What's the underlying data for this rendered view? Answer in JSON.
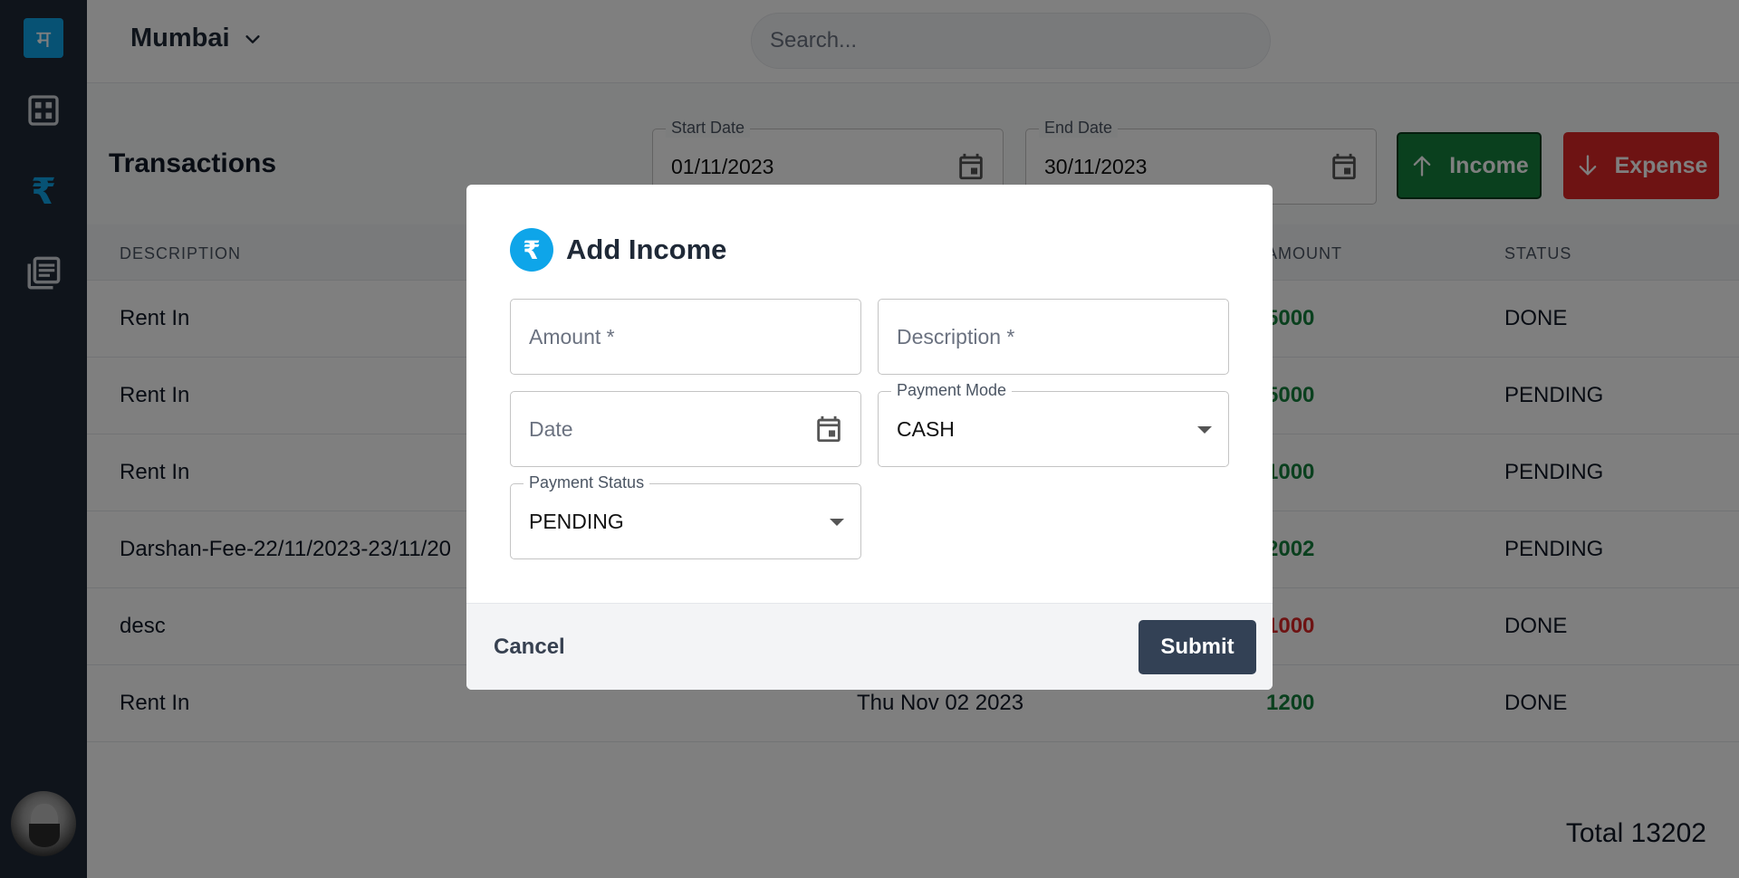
{
  "sidebar": {
    "logo_text": "म",
    "items": [
      {
        "name": "dashboard",
        "icon": "grid-icon"
      },
      {
        "name": "transactions",
        "icon": "rupee-icon",
        "glyph": "₹",
        "active": true
      },
      {
        "name": "ledger",
        "icon": "library-books-icon"
      }
    ],
    "avatar_alt": "user avatar"
  },
  "topbar": {
    "location": "Mumbai",
    "search_placeholder": "Search..."
  },
  "transactions": {
    "title": "Transactions",
    "start_date_label": "Start Date",
    "start_date": "01/11/2023",
    "end_date_label": "End Date",
    "end_date": "30/11/2023",
    "income_label": "Income",
    "expense_label": "Expense",
    "columns": {
      "description": "DESCRIPTION",
      "amount": "AMOUNT",
      "status": "STATUS"
    },
    "rows": [
      {
        "description": "Rent In",
        "date": "",
        "amount": "5000",
        "amount_type": "income",
        "status": "DONE"
      },
      {
        "description": "Rent In",
        "date": "",
        "amount": "5000",
        "amount_type": "income",
        "status": "PENDING"
      },
      {
        "description": "Rent In",
        "date": "",
        "amount": "1000",
        "amount_type": "income",
        "status": "PENDING"
      },
      {
        "description": "Darshan-Fee-22/11/2023-23/11/20",
        "date": "",
        "amount": "2002",
        "amount_type": "income",
        "status": "PENDING"
      },
      {
        "description": "desc",
        "date": "",
        "amount": "1000",
        "amount_type": "expense",
        "status": "DONE"
      },
      {
        "description": "Rent In",
        "date": "Thu Nov 02 2023",
        "amount": "1200",
        "amount_type": "income",
        "status": "DONE"
      }
    ],
    "total": "Total 13202"
  },
  "modal": {
    "title": "Add Income",
    "icon_glyph": "₹",
    "amount_placeholder": "Amount *",
    "description_placeholder": "Description *",
    "date_placeholder": "Date",
    "payment_mode_label": "Payment Mode",
    "payment_mode_value": "CASH",
    "payment_status_label": "Payment Status",
    "payment_status_value": "PENDING",
    "cancel_label": "Cancel",
    "submit_label": "Submit"
  },
  "colors": {
    "sidebar_bg": "#1f2937",
    "accent": "#0ea5e9",
    "income_green": "#15803d",
    "expense_red": "#dc2626",
    "submit_bg": "#334155"
  }
}
